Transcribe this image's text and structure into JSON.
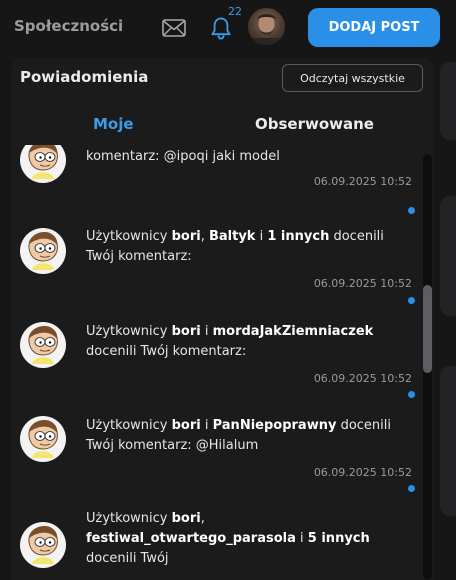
{
  "header": {
    "community_label": "Społeczności",
    "notification_count": "22",
    "add_post_label": "DODAJ POST"
  },
  "panel": {
    "title": "Powiadomienia",
    "read_all_label": "Odczytaj wszystkie",
    "tabs": [
      "Moje",
      "Obserwowane"
    ],
    "active_tab": "Moje"
  },
  "notifications": [
    {
      "parts": [
        {
          "text": "komentarz: @ipoqi jaki model",
          "bold": false
        }
      ],
      "time": "06.09.2025 10:52",
      "unread": true
    },
    {
      "parts": [
        {
          "text": "Użytkownicy ",
          "bold": false
        },
        {
          "text": "bori",
          "bold": true
        },
        {
          "text": ", ",
          "bold": false
        },
        {
          "text": "Baltyk",
          "bold": true
        },
        {
          "text": " i ",
          "bold": false
        },
        {
          "text": "1 innych",
          "bold": true
        },
        {
          "text": " docenili Twój komentarz:",
          "bold": false
        }
      ],
      "time": "06.09.2025 10:52",
      "unread": true
    },
    {
      "parts": [
        {
          "text": "Użytkownicy ",
          "bold": false
        },
        {
          "text": "bori",
          "bold": true
        },
        {
          "text": " i ",
          "bold": false
        },
        {
          "text": "mordaJakZiemniaczek",
          "bold": true
        },
        {
          "text": " docenili Twój komentarz:",
          "bold": false
        }
      ],
      "time": "06.09.2025 10:52",
      "unread": true
    },
    {
      "parts": [
        {
          "text": "Użytkownicy ",
          "bold": false
        },
        {
          "text": "bori",
          "bold": true
        },
        {
          "text": " i ",
          "bold": false
        },
        {
          "text": "PanNiepoprawny",
          "bold": true
        },
        {
          "text": " docenili Twój komentarz: @Hilalum",
          "bold": false
        }
      ],
      "time": "06.09.2025 10:52",
      "unread": true
    },
    {
      "parts": [
        {
          "text": "Użytkownicy ",
          "bold": false
        },
        {
          "text": "bori",
          "bold": true
        },
        {
          "text": ", ",
          "bold": false
        },
        {
          "text": "festiwal_otwartego_parasola",
          "bold": true
        },
        {
          "text": " i ",
          "bold": false
        },
        {
          "text": "5 innych",
          "bold": true
        },
        {
          "text": " docenili Twój",
          "bold": false
        }
      ],
      "time": "",
      "unread": false
    }
  ],
  "colors": {
    "accent": "#2a8fe6",
    "background": "#161617",
    "panel": "#1b1b1c"
  },
  "icons": [
    "mail-icon",
    "bell-icon",
    "user-avatar",
    "notification-avatar"
  ]
}
